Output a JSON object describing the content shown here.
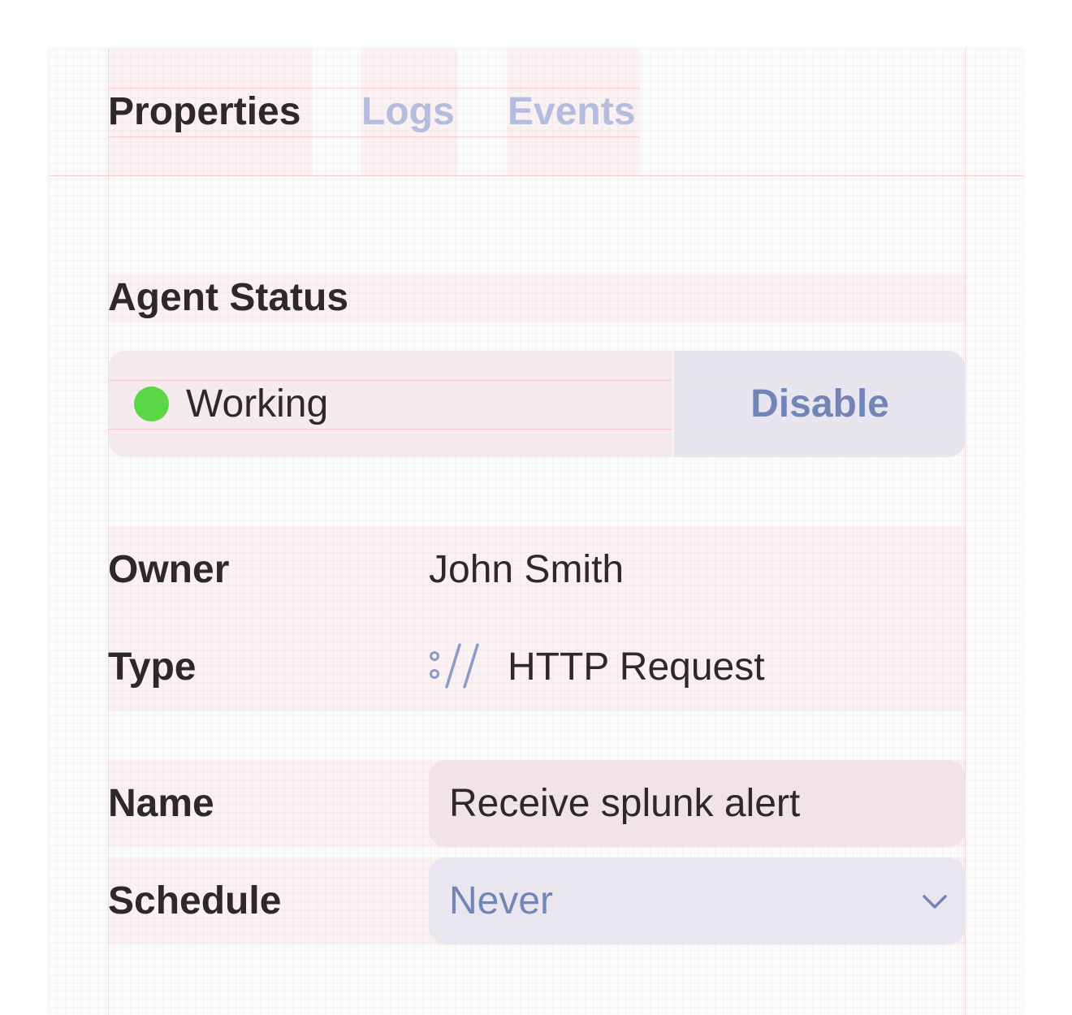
{
  "tabs": [
    {
      "label": "Properties",
      "active": true
    },
    {
      "label": "Logs",
      "active": false
    },
    {
      "label": "Events",
      "active": false
    }
  ],
  "agent_status": {
    "title": "Agent Status",
    "state": "Working",
    "indicator_color": "#5ad646",
    "action_label": "Disable"
  },
  "details": {
    "owner_label": "Owner",
    "owner_value": "John Smith",
    "type_label": "Type",
    "type_icon": "http-request-icon",
    "type_value": "HTTP Request",
    "name_label": "Name",
    "name_value": "Receive splunk alert",
    "schedule_label": "Schedule",
    "schedule_value": "Never",
    "schedule_icon": "chevron-down-icon"
  },
  "colors": {
    "text_primary": "#2e2828",
    "tab_inactive": "#b5bddf",
    "accent": "#7186b6"
  }
}
